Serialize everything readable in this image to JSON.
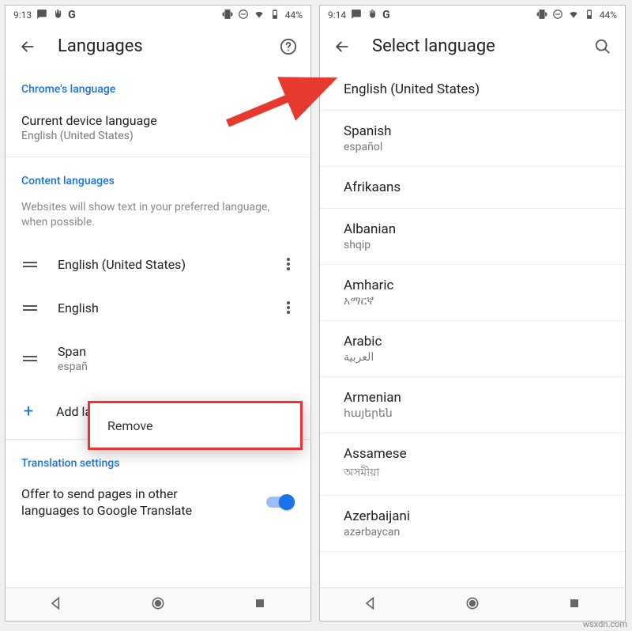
{
  "left": {
    "status": {
      "time": "9:13",
      "battery": "44%"
    },
    "appbar": {
      "title": "Languages"
    },
    "chrome_lang_header": "Chrome's language",
    "current_device": {
      "label": "Current device language",
      "value": "English (United States)"
    },
    "content_lang_header": "Content languages",
    "content_lang_desc": "Websites will show text in your preferred language, when possible.",
    "langs": [
      {
        "primary": "English (United States)",
        "secondary": ""
      },
      {
        "primary": "English",
        "secondary": ""
      },
      {
        "primary": "Span",
        "secondary": "españ"
      }
    ],
    "add_language": "Add language",
    "popup_remove": "Remove",
    "translation_header": "Translation settings",
    "translation_toggle": "Offer to send pages in other\nlanguages to Google Translate"
  },
  "right": {
    "status": {
      "time": "9:14",
      "battery": "44%"
    },
    "appbar": {
      "title": "Select language"
    },
    "items": [
      {
        "primary": "English (United States)",
        "secondary": ""
      },
      {
        "primary": "Spanish",
        "secondary": "español"
      },
      {
        "primary": "Afrikaans",
        "secondary": ""
      },
      {
        "primary": "Albanian",
        "secondary": "shqip"
      },
      {
        "primary": "Amharic",
        "secondary": "አማርኛ"
      },
      {
        "primary": "Arabic",
        "secondary": "العربية"
      },
      {
        "primary": "Armenian",
        "secondary": "հայերեն"
      },
      {
        "primary": "Assamese",
        "secondary": "অসমীয়া"
      },
      {
        "primary": "Azerbaijani",
        "secondary": "azərbaycan"
      }
    ]
  },
  "watermark": "wsxdn.com"
}
